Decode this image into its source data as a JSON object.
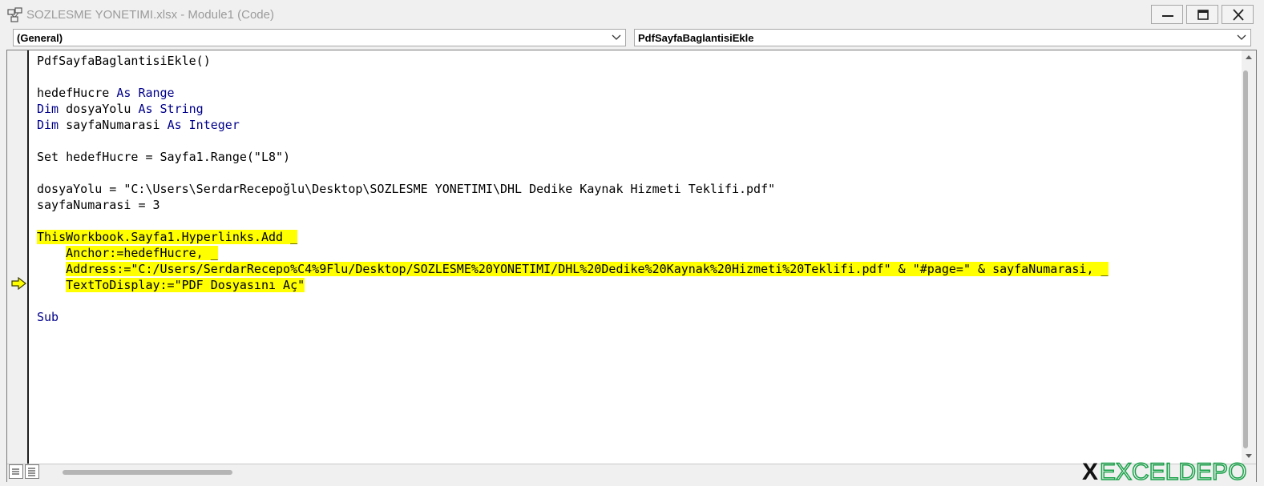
{
  "window": {
    "title": "SOZLESME YONETIMI.xlsx - Module1 (Code)",
    "app_icon": "vba-project-icon",
    "buttons": [
      "minimize-icon",
      "maximize-icon",
      "close-icon"
    ]
  },
  "dropdowns": {
    "object": "(General)",
    "procedure": "PdfSayfaBaglantisiEkle"
  },
  "code": {
    "lines": [
      {
        "text": "PdfSayfaBaglantisiEkle()",
        "highlight": false
      },
      {
        "text": "",
        "highlight": false
      },
      {
        "text": "hedefHucre As Range",
        "highlight": false
      },
      {
        "text": "Dim dosyaYolu As String",
        "highlight": false
      },
      {
        "text": "Dim sayfaNumarasi As Integer",
        "highlight": false
      },
      {
        "text": "",
        "highlight": false
      },
      {
        "text": "Set hedefHucre = Sayfa1.Range(\"L8\")",
        "highlight": false
      },
      {
        "text": "",
        "highlight": false
      },
      {
        "text": "dosyaYolu = \"C:\\Users\\SerdarRecepoğlu\\Desktop\\SOZLESME YONETIMI\\DHL Dedike Kaynak Hizmeti Teklifi.pdf\"",
        "highlight": false
      },
      {
        "text": "sayfaNumarasi = 3",
        "highlight": false
      },
      {
        "text": "",
        "highlight": false
      },
      {
        "text": "ThisWorkbook.Sayfa1.Hyperlinks.Add _",
        "highlight": true,
        "indent": ""
      },
      {
        "text": "Anchor:=hedefHucre, _",
        "highlight": true,
        "indent": "    "
      },
      {
        "text": "Address:=\"C:/Users/SerdarRecepo%C4%9Flu/Desktop/SOZLESME%20YONETIMI/DHL%20Dedike%20Kaynak%20Hizmeti%20Teklifi.pdf\" & \"#page=\" & sayfaNumarasi, _",
        "highlight": true,
        "indent": "    "
      },
      {
        "text": "TextToDisplay:=\"PDF Dosyasını Aç\"",
        "highlight": true,
        "indent": "    "
      },
      {
        "text": "",
        "highlight": false
      },
      {
        "text": "Sub",
        "highlight": false
      }
    ],
    "current_line_icon": "execution-arrow-icon",
    "highlight_color": "#ffff00"
  },
  "footer": {
    "view_buttons": [
      "procedure-view-icon",
      "full-module-view-icon"
    ],
    "logo_text": "EXCELDEPO",
    "logo_icon": "exceldepo-logo-icon"
  },
  "colors": {
    "title_text": "#9b9b9b",
    "keyword": "#00008b",
    "background": "#f0f0f0"
  }
}
